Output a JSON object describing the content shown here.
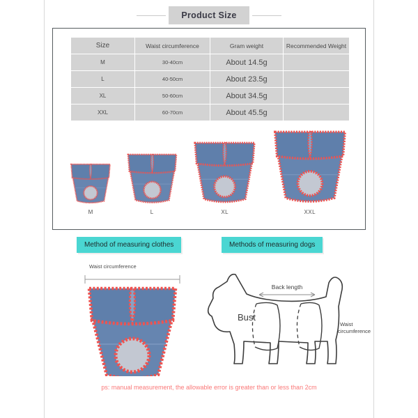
{
  "header": {
    "title": "Product Size"
  },
  "size_table": {
    "columns": [
      "Size",
      "Waist circumference",
      "Gram weight",
      "Recommended Weight"
    ],
    "rows": [
      {
        "size": "M",
        "waist": "30-40cm",
        "gram": "About 14.5g",
        "recommended": ""
      },
      {
        "size": "L",
        "waist": "40-50cm",
        "gram": "About 23.5g",
        "recommended": ""
      },
      {
        "size": "XL",
        "waist": "50-60cm",
        "gram": "About 34.5g",
        "recommended": ""
      },
      {
        "size": "XXL",
        "waist": "60-70cm",
        "gram": "About 45.5g",
        "recommended": ""
      }
    ]
  },
  "products": [
    {
      "label": "M",
      "scale": 0.56
    },
    {
      "label": "L",
      "scale": 0.7
    },
    {
      "label": "XL",
      "scale": 0.86
    },
    {
      "label": "XXL",
      "scale": 1.0
    }
  ],
  "sections": {
    "clothes_chip": "Method of measuring clothes",
    "dogs_chip": "Methods of measuring dogs"
  },
  "clothes_diagram": {
    "waist_label": "Waist circumference"
  },
  "dog_diagram": {
    "bust_label": "Bust",
    "back_length_label": "Back length",
    "waist_label_line1": "Waist",
    "waist_label_line2": "circumference"
  },
  "footer": {
    "note": "ps: manual measurement, the allowable error is greater than or less than 2cm"
  },
  "colors": {
    "teal": "#4ad6d2",
    "denim": "#5b7fad",
    "trim_red": "#ef5350",
    "note_red": "#fa7878",
    "table_gray": "#d3d3d3",
    "panel_border": "#555b5e"
  }
}
